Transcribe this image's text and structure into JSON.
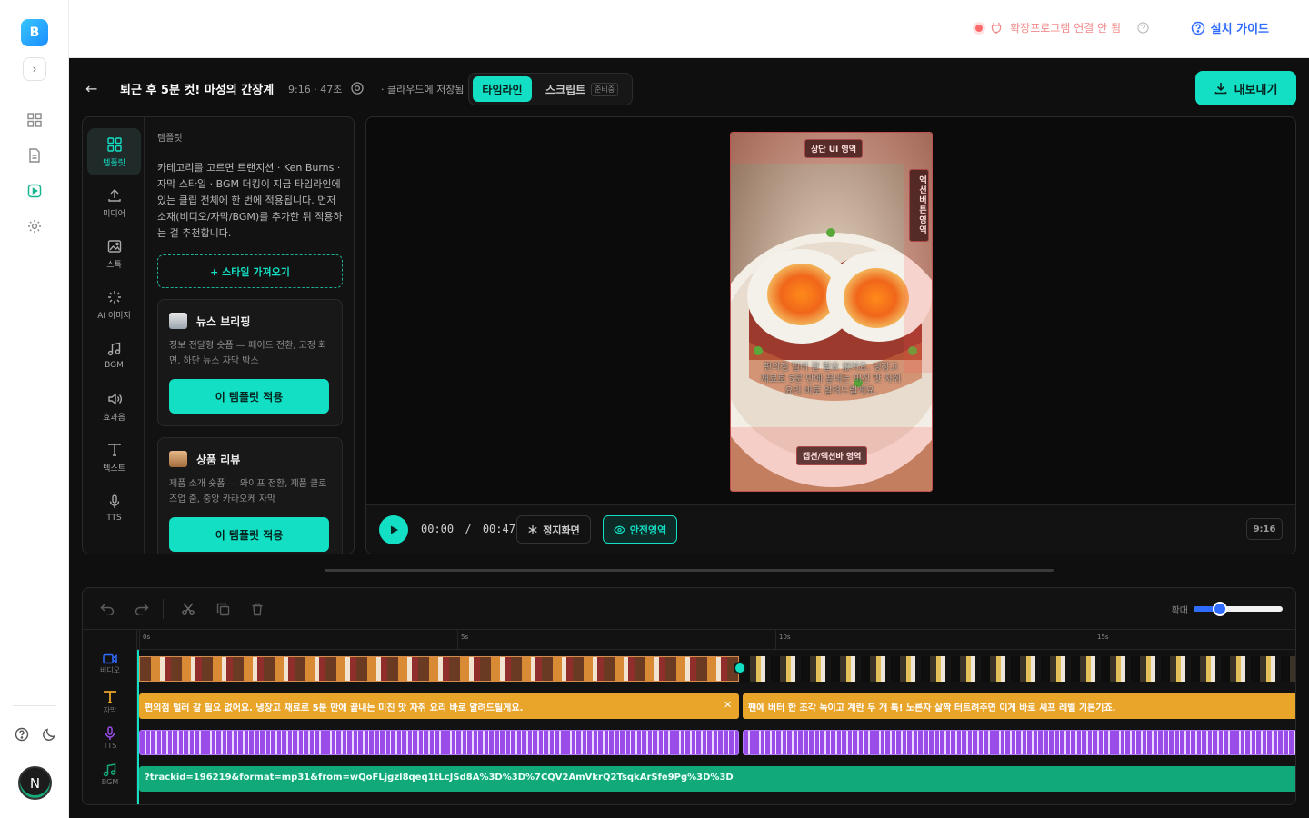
{
  "rail": {
    "logo": "B",
    "avatar": "N"
  },
  "topbar": {
    "extension_status": "확장프로그램 연결 안 됨",
    "guide": "설치 가이드"
  },
  "header": {
    "title": "퇴근 후 5분 컷! 마성의 간장계란밥",
    "meta": "9:16 · 47초",
    "saved": "· 클라우드에 저장됨",
    "tab_timeline": "타임라인",
    "tab_script": "스크립트",
    "beta": "준비중",
    "export": "내보내기"
  },
  "sidetabs": [
    {
      "label": "템플릿",
      "icon": "template-icon",
      "active": true
    },
    {
      "label": "미디어",
      "icon": "upload-icon"
    },
    {
      "label": "스톡",
      "icon": "image-icon"
    },
    {
      "label": "AI 이미지",
      "icon": "sparkle-icon"
    },
    {
      "label": "BGM",
      "icon": "music-icon"
    },
    {
      "label": "효과음",
      "icon": "speaker-icon"
    },
    {
      "label": "텍스트",
      "icon": "text-icon"
    },
    {
      "label": "TTS",
      "icon": "mic-icon"
    }
  ],
  "templates": {
    "section_label": "템플릿",
    "description": "카테고리를 고르면 트랜지션 · Ken Burns · 자막 스타일 · BGM 더킹이 지금 타임라인에 있는 클립 전체에 한 번에 적용됩니다. 먼저 소재(비디오/자막/BGM)를 추가한 뒤 적용하는 걸 추천합니다.",
    "import_button": "+ 스타일 가져오기",
    "cards": [
      {
        "title": "뉴스 브리핑",
        "description": "정보 전달형 숏폼 — 페이드 전환, 고정 화면, 하단 뉴스 자막 박스",
        "apply": "이 템플릿 적용"
      },
      {
        "title": "상품 리뷰",
        "description": "제품 소개 숏폼 — 와이프 전환, 제품 클로즈업 줌, 중앙 카라오케 자막",
        "apply": "이 템플릿 적용"
      }
    ]
  },
  "preview": {
    "safe_top": "상단 UI 영역",
    "safe_right": "액션버튼영역",
    "safe_bottom": "캡션/액션바 영역",
    "subtitle": "편의점 털러 갈 필요 없어요. 냉장고 재료로 5분 만에 끝내는 미친 맛 자취 요리 바로 알려드릴게요.",
    "time_current": "00:00",
    "time_sep": "/",
    "time_total": "00:47",
    "freeze": "정지화면",
    "safe_area": "안전영역",
    "ratio": "9:16"
  },
  "timeline": {
    "zoom_label": "확대",
    "zoom_level": 0.3,
    "ruler": [
      "0s",
      "5s",
      "10s",
      "15s"
    ],
    "track_labels": [
      "비디오",
      "자막",
      "TTS",
      "BGM"
    ],
    "subtitles": [
      "편의점 털러 갈 필요 없어요. 냉장고 재료로 5분 만에 끝내는 미친 맛 자취 요리 바로 알려드릴게요.",
      "팬에 버터 한 조각 녹이고 계란 두 개 톡! 노른자 살짝 터트려주면 이게 바로 셰프 레벨 기본기죠."
    ],
    "bgm": "?trackid=196219&format=mp31&from=wQoFLjgzl8qeq1tLcJSd8A%3D%3D%7CQV2AmVkrQ2TsqkArSfe9Pg%3D%3D"
  },
  "colors": {
    "accent": "#12dfc3",
    "link": "#2f6bff",
    "subtitle_track": "#e9a42a",
    "tts_track": "#9a4ce8",
    "bgm_track": "#11a97a"
  }
}
